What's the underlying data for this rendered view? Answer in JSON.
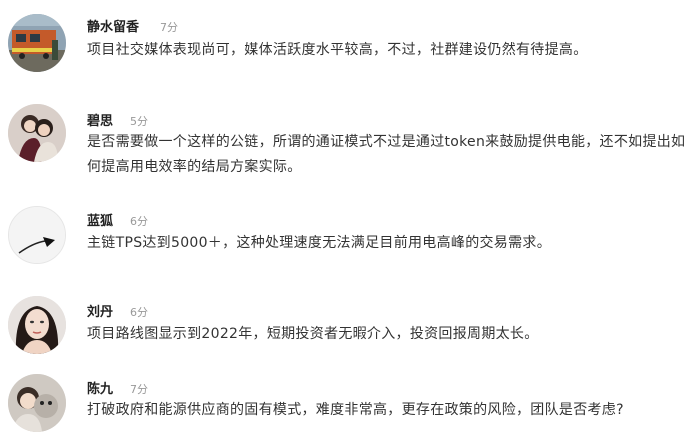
{
  "comments": [
    {
      "user": "静水留香",
      "time": "7分",
      "text": "项目社交媒体表现尚可，媒体活跃度水平较高，不过，社群建设仍然有待提高。",
      "avatar": "train-photo-avatar"
    },
    {
      "user": "碧思",
      "time": "5分",
      "text": "是否需要做一个这样的公链，所谓的通证模式不过是通过token来鼓励提供电能，还不如提出如何提高用电效率的结局方案实际。",
      "avatar": "couple-photo-avatar"
    },
    {
      "user": "蓝狐",
      "time": "6分",
      "text": "主链TPS达到5000＋，这种处理速度无法满足目前用电高峰的交易需求。",
      "avatar": "lamp-minimal-avatar"
    },
    {
      "user": "刘丹",
      "time": "6分",
      "text": "项目路线图显示到2022年，短期投资者无暇介入，投资回报周期太长。",
      "avatar": "woman-portrait-avatar"
    },
    {
      "user": "陈九",
      "time": "7分",
      "text": "打破政府和能源供应商的固有模式，难度非常高，更存在政策的风险，团队是否考虑?",
      "avatar": "child-with-toy-avatar"
    }
  ]
}
